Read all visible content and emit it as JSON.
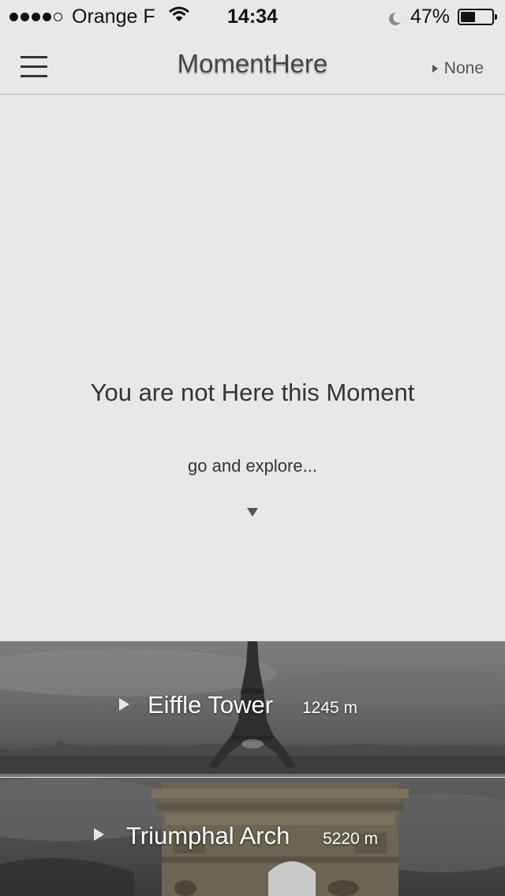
{
  "status_bar": {
    "carrier": "Orange F",
    "time": "14:34",
    "battery_percent": "47%",
    "battery_level": 0.47,
    "signal_bars_filled": 4,
    "signal_bars_total": 5
  },
  "nav": {
    "menu_icon": "hamburger-menu-icon",
    "title": "MomentHere",
    "right_label": "None"
  },
  "empty_state": {
    "title": "You are not Here this Moment",
    "subtitle": "go and explore...",
    "arrow_icon": "triangle-down-icon"
  },
  "places": [
    {
      "name": "Eiffle Tower",
      "distance": "1245 m",
      "icon": "play-triangle-icon"
    },
    {
      "name": "Triumphal Arch",
      "distance": "5220 m",
      "icon": "play-triangle-icon"
    }
  ],
  "colors": {
    "background": "#e8e8e8",
    "text": "#333333",
    "nav_title": "#444444",
    "divider": "#b8b8b8"
  }
}
